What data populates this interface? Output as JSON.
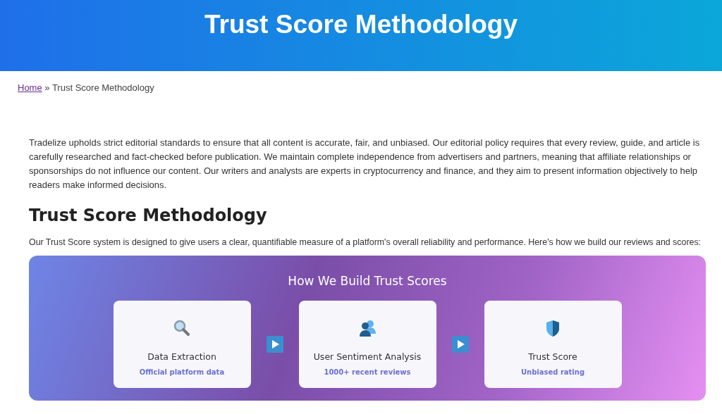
{
  "header": {
    "title": "Trust Score Methodology"
  },
  "breadcrumb": {
    "link": "Home",
    "separator": "»",
    "current": "Trust Score Methodology"
  },
  "intro_paragraph": "Tradelize upholds strict editorial standards to ensure that all content is accurate, fair, and unbiased. Our editorial policy requires that every review, guide, and article is carefully researched and fact-checked before publication. We maintain complete independence from advertisers and partners, meaning that affiliate relationships or sponsorships do not influence our content. Our writers and analysts are experts in cryptocurrency and finance, and they aim to present information objectively to help readers make informed decisions.",
  "section": {
    "heading": "Trust Score Methodology",
    "text": "Our Trust Score system is designed to give users a clear, quantifiable measure of a platform's overall reliability and performance. Here's how we build our reviews and scores:"
  },
  "process_panel": {
    "title": "How We Build Trust Scores",
    "steps": [
      {
        "kind": "search",
        "title": "Data Extraction",
        "subtitle": "Official platform data"
      },
      {
        "kind": "users",
        "title": "User Sentiment Analysis",
        "subtitle": "1000+ recent reviews"
      },
      {
        "kind": "shield",
        "title": "Trust Score",
        "subtitle": "Unbiased rating"
      }
    ]
  }
}
